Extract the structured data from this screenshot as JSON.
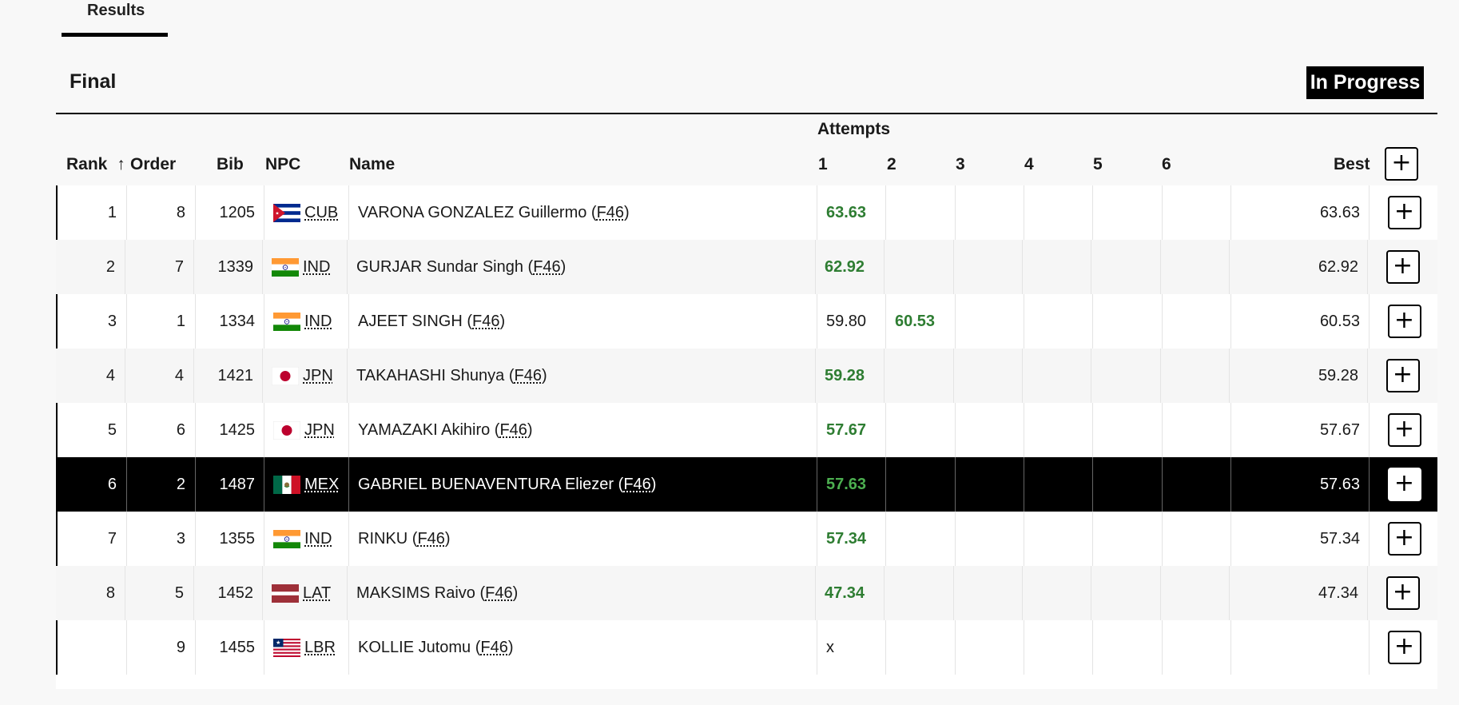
{
  "tabs": {
    "results": "Results"
  },
  "section": {
    "title": "Final",
    "status": "In Progress"
  },
  "headers": {
    "rank": "Rank",
    "sort_arrow": "↑",
    "order": "Order",
    "bib": "Bib",
    "npc": "NPC",
    "name": "Name",
    "attempts": "Attempts",
    "a1": "1",
    "a2": "2",
    "a3": "3",
    "a4": "4",
    "a5": "5",
    "a6": "6",
    "best": "Best",
    "plus": "+"
  },
  "rows": [
    {
      "rank": "1",
      "order": "8",
      "bib": "1205",
      "flag": "CUB",
      "npc": "CUB",
      "name": "VARONA GONZALEZ Guillermo",
      "cls": "F46",
      "a1": "63.63",
      "a2": "",
      "best": "63.63",
      "btn": "+"
    },
    {
      "rank": "2",
      "order": "7",
      "bib": "1339",
      "flag": "IND",
      "npc": "IND",
      "name": "GURJAR Sundar Singh",
      "cls": "F46",
      "a1": "62.92",
      "a2": "",
      "best": "62.92",
      "btn": "+"
    },
    {
      "rank": "3",
      "order": "1",
      "bib": "1334",
      "flag": "IND",
      "npc": "IND",
      "name": "AJEET SINGH",
      "cls": "F46",
      "a1": "59.80",
      "a2": "60.53",
      "best": "60.53",
      "btn": "+"
    },
    {
      "rank": "4",
      "order": "4",
      "bib": "1421",
      "flag": "JPN",
      "npc": "JPN",
      "name": "TAKAHASHI Shunya",
      "cls": "F46",
      "a1": "59.28",
      "a2": "",
      "best": "59.28",
      "btn": "+"
    },
    {
      "rank": "5",
      "order": "6",
      "bib": "1425",
      "flag": "JPN",
      "npc": "JPN",
      "name": "YAMAZAKI Akihiro",
      "cls": "F46",
      "a1": "57.67",
      "a2": "",
      "best": "57.67",
      "btn": "+"
    },
    {
      "rank": "6",
      "order": "2",
      "bib": "1487",
      "flag": "MEX",
      "npc": "MEX",
      "name": "GABRIEL BUENAVENTURA Eliezer",
      "cls": "F46",
      "a1": "57.63",
      "a2": "",
      "best": "57.63",
      "btn": "+"
    },
    {
      "rank": "7",
      "order": "3",
      "bib": "1355",
      "flag": "IND",
      "npc": "IND",
      "name": "RINKU",
      "cls": "F46",
      "a1": "57.34",
      "a2": "",
      "best": "57.34",
      "btn": "+"
    },
    {
      "rank": "8",
      "order": "5",
      "bib": "1452",
      "flag": "LAT",
      "npc": "LAT",
      "name": "MAKSIMS Raivo",
      "cls": "F46",
      "a1": "47.34",
      "a2": "",
      "best": "47.34",
      "btn": "+"
    },
    {
      "rank": "",
      "order": "9",
      "bib": "1455",
      "flag": "LBR",
      "npc": "LBR",
      "name": "KOLLIE Jutomu",
      "cls": "F46",
      "a1": "x",
      "a2": "",
      "best": "",
      "btn": "+"
    }
  ],
  "colors": {
    "good_mark": "#2e7d32",
    "highlight_row": "#000000"
  }
}
